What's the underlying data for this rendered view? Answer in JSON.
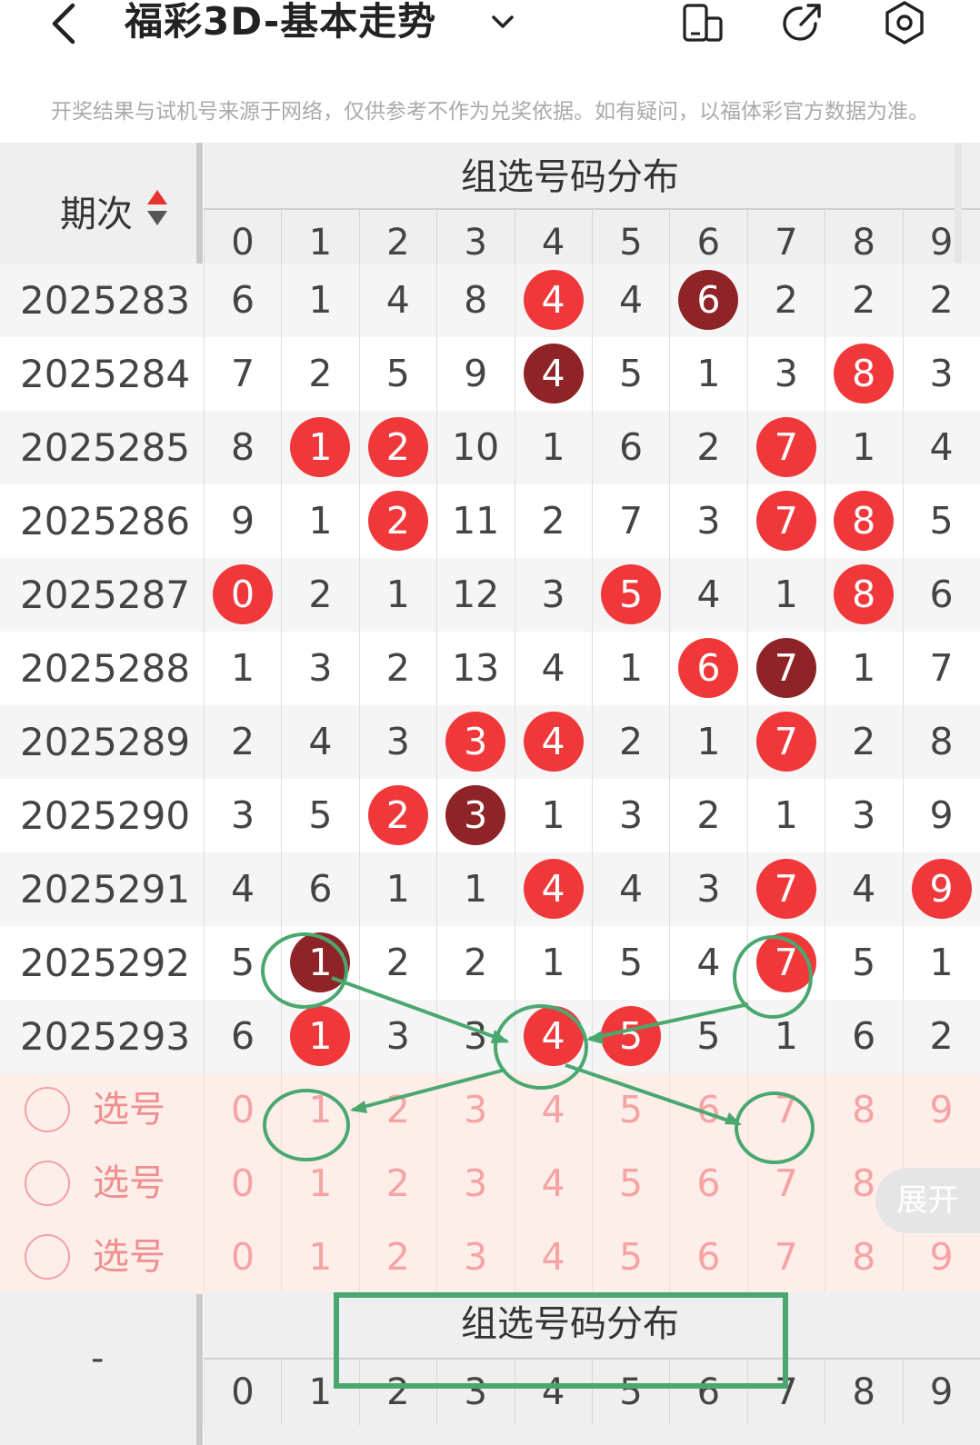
{
  "nav": {
    "title": "福彩3D-基本走势",
    "back_icon": "chevron-left-icon",
    "dropdown_icon": "chevron-down-icon",
    "icons": [
      "phone-layout-icon",
      "share-icon",
      "settings-icon"
    ]
  },
  "notice": "开奖结果与试机号来源于网络，仅供参考不作为兑奖依据。如有疑问，以福体彩官方数据为准。",
  "table": {
    "issue_header": "期次",
    "group_title": "组选号码分布",
    "digits": [
      "0",
      "1",
      "2",
      "3",
      "4",
      "5",
      "6",
      "7",
      "8",
      "9"
    ],
    "colors": {
      "hit": "#f0383b",
      "repeat": "#8e2427",
      "annotation": "#4aa86f"
    },
    "rows": [
      {
        "issue": "2025283",
        "cells": [
          "6",
          "1",
          "4",
          "8",
          "4",
          "4",
          "6",
          "2",
          "2",
          "2"
        ],
        "hits": [
          4,
          6
        ],
        "dark": [
          6
        ]
      },
      {
        "issue": "2025284",
        "cells": [
          "7",
          "2",
          "5",
          "9",
          "4",
          "5",
          "1",
          "3",
          "8",
          "3"
        ],
        "hits": [
          4,
          8
        ],
        "dark": [
          4
        ]
      },
      {
        "issue": "2025285",
        "cells": [
          "8",
          "1",
          "2",
          "10",
          "1",
          "6",
          "2",
          "7",
          "1",
          "4"
        ],
        "hits": [
          1,
          2,
          7
        ],
        "dark": []
      },
      {
        "issue": "2025286",
        "cells": [
          "9",
          "1",
          "2",
          "11",
          "2",
          "7",
          "3",
          "7",
          "8",
          "5"
        ],
        "hits": [
          2,
          7,
          8
        ],
        "dark": []
      },
      {
        "issue": "2025287",
        "cells": [
          "0",
          "2",
          "1",
          "12",
          "3",
          "5",
          "4",
          "1",
          "8",
          "6"
        ],
        "hits": [
          0,
          5,
          8
        ],
        "dark": []
      },
      {
        "issue": "2025288",
        "cells": [
          "1",
          "3",
          "2",
          "13",
          "4",
          "1",
          "6",
          "7",
          "1",
          "7"
        ],
        "hits": [
          6,
          7
        ],
        "dark": [
          7
        ]
      },
      {
        "issue": "2025289",
        "cells": [
          "2",
          "4",
          "3",
          "3",
          "4",
          "2",
          "1",
          "7",
          "2",
          "8"
        ],
        "hits": [
          3,
          4,
          7
        ],
        "dark": []
      },
      {
        "issue": "2025290",
        "cells": [
          "3",
          "5",
          "2",
          "3",
          "1",
          "3",
          "2",
          "1",
          "3",
          "9"
        ],
        "hits": [
          2,
          3
        ],
        "dark": [
          3
        ]
      },
      {
        "issue": "2025291",
        "cells": [
          "4",
          "6",
          "1",
          "1",
          "4",
          "4",
          "3",
          "7",
          "4",
          "9"
        ],
        "hits": [
          4,
          7,
          9
        ],
        "dark": []
      },
      {
        "issue": "2025292",
        "cells": [
          "5",
          "1",
          "2",
          "2",
          "1",
          "5",
          "4",
          "7",
          "5",
          "1"
        ],
        "hits": [
          1,
          7
        ],
        "dark": [
          1
        ]
      },
      {
        "issue": "2025293",
        "cells": [
          "6",
          "1",
          "3",
          "3",
          "4",
          "5",
          "5",
          "1",
          "6",
          "2"
        ],
        "hits": [
          1,
          4,
          5
        ],
        "dark": []
      }
    ],
    "pick_rows": [
      {
        "label": "选号"
      },
      {
        "label": "选号"
      },
      {
        "label": "选号"
      }
    ],
    "footer": {
      "issue_placeholder": "-",
      "group_title": "组选号码分布"
    },
    "expand_label": "展开"
  }
}
